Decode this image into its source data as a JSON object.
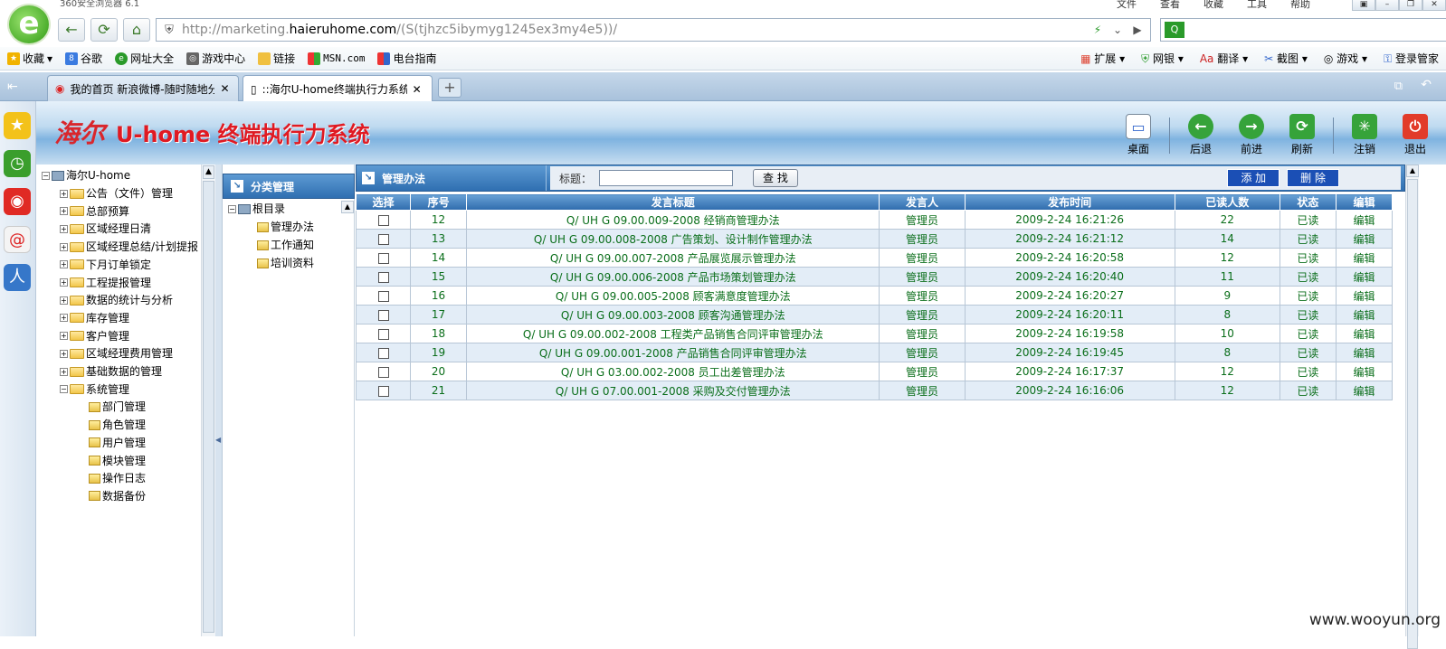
{
  "browser": {
    "title": "360安全浏览器 6.1",
    "menu": [
      "文件",
      "查看",
      "收藏",
      "工具",
      "帮助"
    ],
    "url_prefix": "http://marketing.",
    "url_domain": "haieruhome.com",
    "url_suffix": "/(S(tjhzc5ibymyg1245ex3my4e5))/",
    "bookmarks": [
      {
        "label": "收藏",
        "icon": "star-icon"
      },
      {
        "label": "谷歌",
        "icon": "google-icon"
      },
      {
        "label": "网址大全",
        "icon": "globe-icon"
      },
      {
        "label": "游戏中心",
        "icon": "gamepad-icon"
      },
      {
        "label": "链接",
        "icon": "folder-icon"
      },
      {
        "label": "MSN.com",
        "icon": "msn-icon"
      },
      {
        "label": "电台指南",
        "icon": "windows-icon"
      }
    ],
    "extensions": [
      "扩展",
      "网银",
      "翻译",
      "截图",
      "游戏",
      "登录管家"
    ],
    "tabs": [
      {
        "label": "我的首页 新浪微博-随时随地分",
        "icon": "weibo-icon"
      },
      {
        "label": "::海尔U-home终端执行力系统::",
        "icon": "page-icon"
      }
    ]
  },
  "app": {
    "brand": "海尔",
    "name": "U-home 终端执行力系统",
    "toolbar": [
      "桌面",
      "后退",
      "前进",
      "刷新",
      "注销",
      "退出"
    ]
  },
  "tree": {
    "root": "海尔U-home",
    "items": [
      {
        "label": "公告（文件）管理",
        "expanded": false
      },
      {
        "label": "总部预算",
        "expanded": false
      },
      {
        "label": "区域经理日清",
        "expanded": false
      },
      {
        "label": "区域经理总结/计划提报",
        "expanded": false
      },
      {
        "label": "下月订单锁定",
        "expanded": false
      },
      {
        "label": "工程提报管理",
        "expanded": false
      },
      {
        "label": "数据的统计与分析",
        "expanded": false
      },
      {
        "label": "库存管理",
        "expanded": false
      },
      {
        "label": "客户管理",
        "expanded": false
      },
      {
        "label": "区域经理费用管理",
        "expanded": false
      },
      {
        "label": "基础数据的管理",
        "expanded": false
      },
      {
        "label": "系统管理",
        "expanded": true
      }
    ],
    "children": [
      "部门管理",
      "角色管理",
      "用户管理",
      "模块管理",
      "操作日志",
      "数据备份"
    ]
  },
  "category": {
    "title": "分类管理",
    "root": "根目录",
    "items": [
      "管理办法",
      "工作通知",
      "培训资料"
    ]
  },
  "main": {
    "title": "管理办法",
    "filter_label": "标题：",
    "search_btn": "查 找",
    "add_btn": "添 加",
    "delete_btn": "删 除",
    "columns": [
      "选择",
      "序号",
      "发言标题",
      "发言人",
      "发布时间",
      "已读人数",
      "状态",
      "编辑"
    ],
    "rows": [
      {
        "no": "12",
        "title": "Q/ UH G 09.00.009-2008 经销商管理办法",
        "author": "管理员",
        "time": "2009-2-24 16:21:26",
        "read": "22",
        "status": "已读",
        "edit": "编辑"
      },
      {
        "no": "13",
        "title": "Q/ UH G 09.00.008-2008 广告策划、设计制作管理办法",
        "author": "管理员",
        "time": "2009-2-24 16:21:12",
        "read": "14",
        "status": "已读",
        "edit": "编辑"
      },
      {
        "no": "14",
        "title": "Q/ UH G 09.00.007-2008 产品展览展示管理办法",
        "author": "管理员",
        "time": "2009-2-24 16:20:58",
        "read": "12",
        "status": "已读",
        "edit": "编辑"
      },
      {
        "no": "15",
        "title": "Q/ UH G 09.00.006-2008 产品市场策划管理办法",
        "author": "管理员",
        "time": "2009-2-24 16:20:40",
        "read": "11",
        "status": "已读",
        "edit": "编辑"
      },
      {
        "no": "16",
        "title": "Q/ UH G 09.00.005-2008 顾客满意度管理办法",
        "author": "管理员",
        "time": "2009-2-24 16:20:27",
        "read": "9",
        "status": "已读",
        "edit": "编辑"
      },
      {
        "no": "17",
        "title": "Q/ UH G 09.00.003-2008 顾客沟通管理办法",
        "author": "管理员",
        "time": "2009-2-24 16:20:11",
        "read": "8",
        "status": "已读",
        "edit": "编辑"
      },
      {
        "no": "18",
        "title": "Q/ UH G 09.00.002-2008 工程类产品销售合同评审管理办法",
        "author": "管理员",
        "time": "2009-2-24 16:19:58",
        "read": "10",
        "status": "已读",
        "edit": "编辑"
      },
      {
        "no": "19",
        "title": "Q/ UH G 09.00.001-2008 产品销售合同评审管理办法",
        "author": "管理员",
        "time": "2009-2-24 16:19:45",
        "read": "8",
        "status": "已读",
        "edit": "编辑"
      },
      {
        "no": "20",
        "title": "Q/ UH G 03.00.002-2008 员工出差管理办法",
        "author": "管理员",
        "time": "2009-2-24 16:17:37",
        "read": "12",
        "status": "已读",
        "edit": "编辑"
      },
      {
        "no": "21",
        "title": "Q/ UH G 07.00.001-2008 采购及交付管理办法",
        "author": "管理员",
        "time": "2009-2-24 16:16:06",
        "read": "12",
        "status": "已读",
        "edit": "编辑"
      }
    ]
  },
  "watermark": "www.wooyun.org",
  "colors": {
    "accent": "#2f6fb1",
    "cell_text": "#0a6e1a",
    "brand_red": "#e01a22"
  }
}
